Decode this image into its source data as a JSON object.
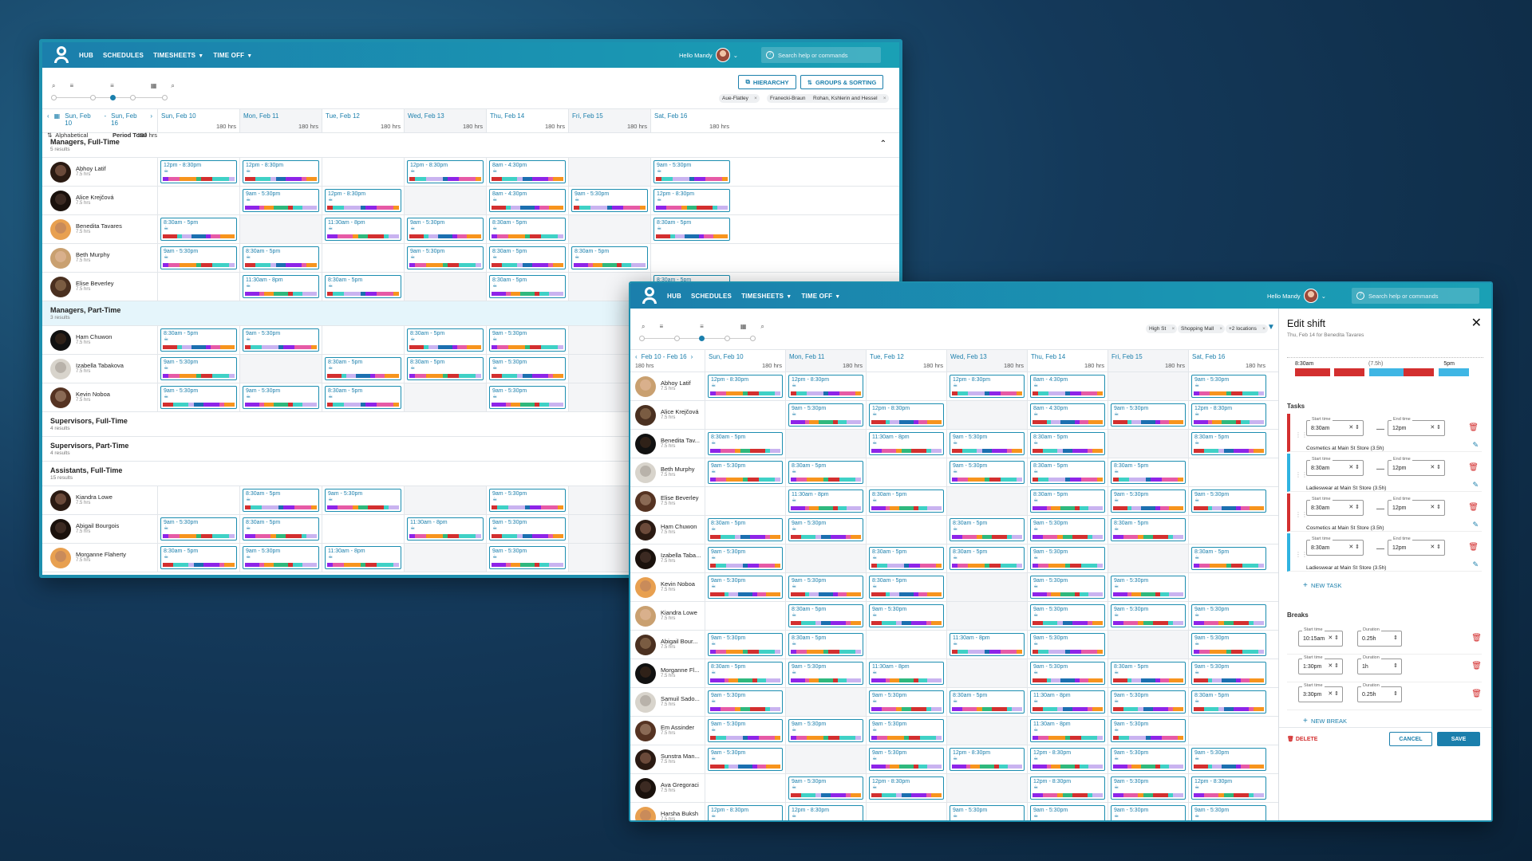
{
  "colors": {
    "purple": "#8e24e8",
    "teal": "#3fd1c6",
    "orange": "#f7941d",
    "blue": "#1b6fb0",
    "red": "#d32f2f",
    "pink": "#e65aa6",
    "lavender": "#c9b3f0",
    "green": "#2fb87d",
    "sky": "#3fb6e4"
  },
  "nav": {
    "items": [
      "HUB",
      "SCHEDULES",
      "TIMESHEETS",
      "TIME OFF"
    ],
    "greeting": "Hello Mandy",
    "search_placeholder": "Search help or commands"
  },
  "back": {
    "buttons": {
      "hierarchy": "HIERARCHY",
      "groups": "GROUPS & SORTING"
    },
    "chips": [
      "Aue-Flatley",
      "Franecki-Braun",
      "Rohan, Kshlerin and Hessel"
    ],
    "range": {
      "from": "Sun, Feb 10",
      "sep": "-",
      "to": "Sun, Feb 16"
    },
    "sort": "Alphabetical",
    "period_label": "Period Total",
    "period_hrs": "180 hrs",
    "days": [
      {
        "label": "Sun, Feb 10",
        "hrs": "180 hrs"
      },
      {
        "label": "Mon, Feb 11",
        "hrs": "180 hrs"
      },
      {
        "label": "Tue, Feb 12",
        "hrs": "180 hrs"
      },
      {
        "label": "Wed, Feb 13",
        "hrs": "180 hrs"
      },
      {
        "label": "Thu, Feb 14",
        "hrs": "180 hrs"
      },
      {
        "label": "Fri, Feb 15",
        "hrs": "180 hrs"
      },
      {
        "label": "Sat, Feb 16",
        "hrs": "180 hrs"
      }
    ],
    "rows": [
      {
        "type": "group",
        "name": "Managers, Full-Time",
        "sub": "5 results"
      },
      {
        "type": "emp",
        "name": "Abhoy Latif",
        "hrs": "7.5 hrs",
        "shifts": [
          "12pm - 8:30pm",
          "12pm - 8:30pm",
          "",
          "12pm - 8:30pm",
          "8am - 4:30pm",
          "",
          "9am - 5:30pm"
        ]
      },
      {
        "type": "emp",
        "name": "Alice Krejčová",
        "hrs": "7.5 hrs",
        "shifts": [
          "",
          "9am - 5:30pm",
          "12pm - 8:30pm",
          "",
          "8am - 4:30pm",
          "9am - 5:30pm",
          "12pm - 8:30pm"
        ]
      },
      {
        "type": "emp",
        "name": "Benedita Tavares",
        "hrs": "7.5 hrs",
        "shifts": [
          "8:30am - 5pm",
          "",
          "11:30am - 8pm",
          "9am - 5:30pm",
          "8:30am - 5pm",
          "",
          "8:30am - 5pm"
        ]
      },
      {
        "type": "emp",
        "name": "Beth Murphy",
        "hrs": "7.5 hrs",
        "shifts": [
          "9am - 5:30pm",
          "8:30am - 5pm",
          "",
          "9am - 5:30pm",
          "8:30am - 5pm",
          "8:30am - 5pm",
          ""
        ]
      },
      {
        "type": "emp",
        "name": "Elise Beverley",
        "hrs": "7.5 hrs",
        "shifts": [
          "",
          "11:30am - 8pm",
          "8:30am - 5pm",
          "",
          "8:30am - 5pm",
          "",
          "8:30am - 5pm"
        ]
      },
      {
        "type": "group",
        "name": "Managers, Part-Time",
        "sub": "3 results",
        "selected": true
      },
      {
        "type": "emp",
        "name": "Ham Chuwon",
        "hrs": "7.5 hrs",
        "shifts": [
          "8:30am - 5pm",
          "9am - 5:30pm",
          "",
          "8:30am - 5pm",
          "9am - 5:30pm",
          "",
          ""
        ]
      },
      {
        "type": "emp",
        "name": "Izabella Tabakova",
        "hrs": "7.5 hrs",
        "shifts": [
          "9am - 5:30pm",
          "",
          "8:30am - 5pm",
          "8:30am - 5pm",
          "9am - 5:30pm",
          "",
          ""
        ]
      },
      {
        "type": "emp",
        "name": "Kevin Noboa",
        "hrs": "7.5 hrs",
        "shifts": [
          "9am - 5:30pm",
          "9am - 5:30pm",
          "8:30am - 5pm",
          "",
          "9am - 5:30pm",
          "",
          ""
        ]
      },
      {
        "type": "group",
        "name": "Supervisors, Full-Time",
        "sub": "4 results"
      },
      {
        "type": "group",
        "name": "Supervisors, Part-Time",
        "sub": "4 results"
      },
      {
        "type": "group",
        "name": "Assistants, Full-Time",
        "sub": "15 results"
      },
      {
        "type": "emp",
        "name": "Kiandra Lowe",
        "hrs": "7.5 hrs",
        "shifts": [
          "",
          "8:30am - 5pm",
          "9am - 5:30pm",
          "",
          "9am - 5:30pm",
          "",
          ""
        ]
      },
      {
        "type": "emp",
        "name": "Abigail Bourgois",
        "hrs": "7.5 hrs",
        "shifts": [
          "9am - 5:30pm",
          "8:30am - 5pm",
          "",
          "11:30am - 8pm",
          "9am - 5:30pm",
          "",
          ""
        ]
      },
      {
        "type": "emp",
        "name": "Morganne Flaherty",
        "hrs": "7.5 hrs",
        "shifts": [
          "8:30am - 5pm",
          "9am - 5:30pm",
          "11:30am - 8pm",
          "",
          "9am - 5:30pm",
          "",
          ""
        ]
      }
    ]
  },
  "front": {
    "chips": [
      "High St",
      "Shopping Mall",
      "+2 locations"
    ],
    "range": "Feb 10 - Feb 16",
    "period_hrs": "180 hrs",
    "days": [
      {
        "label": "Sun, Feb 10",
        "hrs": "180 hrs"
      },
      {
        "label": "Mon, Feb 11",
        "hrs": "180 hrs"
      },
      {
        "label": "Tue, Feb 12",
        "hrs": "180 hrs"
      },
      {
        "label": "Wed, Feb 13",
        "hrs": "180 hrs"
      },
      {
        "label": "Thu, Feb 14",
        "hrs": "180 hrs"
      },
      {
        "label": "Fri, Feb 15",
        "hrs": "180 hrs"
      },
      {
        "label": "Sat, Feb 16",
        "hrs": "180 hrs"
      }
    ],
    "rows": [
      {
        "name": "Abhoy Latif",
        "hrs": "7.5 hrs",
        "shifts": [
          "12pm - 8:30pm",
          "12pm - 8:30pm",
          "",
          "12pm - 8:30pm",
          "8am - 4:30pm",
          "",
          "9am - 5:30pm"
        ]
      },
      {
        "name": "Alice Krejčová",
        "hrs": "7.5 hrs",
        "shifts": [
          "",
          "9am - 5:30pm",
          "12pm - 8:30pm",
          "",
          "8am - 4:30pm",
          "9am - 5:30pm",
          "12pm - 8:30pm"
        ]
      },
      {
        "name": "Benedita Tav...",
        "hrs": "7.5 hrs",
        "shifts": [
          "8:30am - 5pm",
          "",
          "11:30am - 8pm",
          "9am - 5:30pm",
          "8:30am - 5pm",
          "",
          "8:30am - 5pm"
        ]
      },
      {
        "name": "Beth Murphy",
        "hrs": "7.5 hrs",
        "shifts": [
          "9am - 5:30pm",
          "8:30am - 5pm",
          "",
          "9am - 5:30pm",
          "8:30am - 5pm",
          "8:30am - 5pm",
          ""
        ]
      },
      {
        "name": "Elise Beverley",
        "hrs": "7.5 hrs",
        "shifts": [
          "",
          "11:30am - 8pm",
          "8:30am - 5pm",
          "",
          "8:30am - 5pm",
          "9am - 5:30pm",
          "9am - 5:30pm"
        ]
      },
      {
        "name": "Ham Chuwon",
        "hrs": "7.5 hrs",
        "shifts": [
          "8:30am - 5pm",
          "9am - 5:30pm",
          "",
          "8:30am - 5pm",
          "9am - 5:30pm",
          "8:30am - 5pm",
          ""
        ]
      },
      {
        "name": "Izabella Taba...",
        "hrs": "7.5 hrs",
        "shifts": [
          "9am - 5:30pm",
          "",
          "8:30am - 5pm",
          "8:30am - 5pm",
          "9am - 5:30pm",
          "",
          "8:30am - 5pm"
        ]
      },
      {
        "name": "Kevin Noboa",
        "hrs": "7.5 hrs",
        "shifts": [
          "9am - 5:30pm",
          "9am - 5:30pm",
          "8:30am - 5pm",
          "",
          "9am - 5:30pm",
          "9am - 5:30pm",
          ""
        ]
      },
      {
        "name": "Kiandra Lowe",
        "hrs": "7.5 hrs",
        "shifts": [
          "",
          "8:30am - 5pm",
          "9am - 5:30pm",
          "",
          "9am - 5:30pm",
          "9am - 5:30pm",
          "9am - 5:30pm"
        ]
      },
      {
        "name": "Abigail Bour...",
        "hrs": "7.5 hrs",
        "shifts": [
          "9am - 5:30pm",
          "8:30am - 5pm",
          "",
          "11:30am - 8pm",
          "9am - 5:30pm",
          "",
          "9am - 5:30pm"
        ]
      },
      {
        "name": "Morganne Fl...",
        "hrs": "7.5 hrs",
        "shifts": [
          "8:30am - 5pm",
          "9am - 5:30pm",
          "11:30am - 8pm",
          "",
          "9am - 5:30pm",
          "8:30am - 5pm",
          "9am - 5:30pm"
        ]
      },
      {
        "name": "Samuil Sado...",
        "hrs": "7.5 hrs",
        "shifts": [
          "9am - 5:30pm",
          "",
          "9am - 5:30pm",
          "8:30am - 5pm",
          "11:30am - 8pm",
          "9am - 5:30pm",
          "8:30am - 5pm"
        ]
      },
      {
        "name": "Em Assinder",
        "hrs": "7.5 hrs",
        "shifts": [
          "9am - 5:30pm",
          "9am - 5:30pm",
          "9am - 5:30pm",
          "",
          "11:30am - 8pm",
          "9am - 5:30pm",
          ""
        ]
      },
      {
        "name": "Sunstra Man...",
        "hrs": "7.5 hrs",
        "shifts": [
          "9am - 5:30pm",
          "",
          "9am - 5:30pm",
          "12pm - 8:30pm",
          "12pm - 8:30pm",
          "9am - 5:30pm",
          "9am - 5:30pm"
        ]
      },
      {
        "name": "Ava Gregoraci",
        "hrs": "7.5 hrs",
        "shifts": [
          "",
          "9am - 5:30pm",
          "12pm - 8:30pm",
          "",
          "12pm - 8:30pm",
          "9am - 5:30pm",
          "12pm - 8:30pm"
        ]
      },
      {
        "name": "Harsha Buksh",
        "hrs": "7.5 hrs",
        "shifts": [
          "12pm - 8:30pm",
          "12pm - 8:30pm",
          "",
          "9am - 5:30pm",
          "9am - 5:30pm",
          "9am - 5:30pm",
          "9am - 5:30pm"
        ]
      }
    ]
  },
  "edit": {
    "title": "Edit shift",
    "subtitle": "Thu, Feb 14 for Benedita Tavares",
    "timeline": {
      "start": "8:30am",
      "mid": "(7.5h)",
      "end": "5pm"
    },
    "tasks_label": "Tasks",
    "start_label": "Start time",
    "end_label": "End time",
    "tasks": [
      {
        "start": "8:30am",
        "end": "12pm",
        "location": "Cosmetics at Main St Store (3.5h)",
        "color": "red"
      },
      {
        "start": "8:30am",
        "end": "12pm",
        "location": "Ladieswear at Main St Store (3.5h)",
        "color": "blue"
      },
      {
        "start": "8:30am",
        "end": "12pm",
        "location": "Cosmetics at Main St Store (3.5h)",
        "color": "red"
      },
      {
        "start": "8:30am",
        "end": "12pm",
        "location": "Ladieswear at Main St Store (3.5h)",
        "color": "blue"
      }
    ],
    "new_task": "NEW TASK",
    "breaks_label": "Breaks",
    "duration_label": "Duration",
    "breaks": [
      {
        "start": "10:15am",
        "duration": "0.25h"
      },
      {
        "start": "1:30pm",
        "duration": "1h"
      },
      {
        "start": "3:30pm",
        "duration": "0.25h"
      }
    ],
    "new_break": "NEW BREAK",
    "delete": "DELETE",
    "cancel": "CANCEL",
    "save": "SAVE"
  }
}
